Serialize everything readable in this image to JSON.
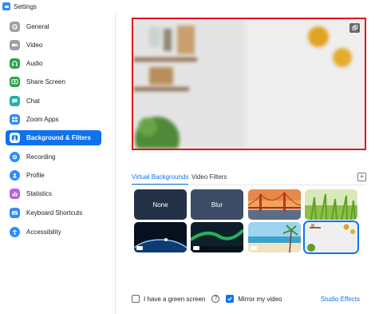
{
  "window": {
    "title": "Settings",
    "icon": "zoom-app-icon"
  },
  "sidebar": {
    "items": [
      {
        "label": "General",
        "icon": "gear-icon",
        "color": "#9aa0a6",
        "active": false
      },
      {
        "label": "Video",
        "icon": "video-icon",
        "color": "#9aa0a6",
        "active": false
      },
      {
        "label": "Audio",
        "icon": "headphones-icon",
        "color": "#2fa24a",
        "active": false
      },
      {
        "label": "Share Screen",
        "icon": "share-screen-icon",
        "color": "#2fa24a",
        "active": false
      },
      {
        "label": "Chat",
        "icon": "chat-icon",
        "color": "#1ab3a6",
        "active": false
      },
      {
        "label": "Zoom Apps",
        "icon": "zoom-apps-icon",
        "color": "#2d8cff",
        "active": false
      },
      {
        "label": "Background & Filters",
        "icon": "background-icon",
        "color": "#ffffff",
        "active": true
      },
      {
        "label": "Recording",
        "icon": "record-icon",
        "color": "#2d8cff",
        "active": false
      },
      {
        "label": "Profile",
        "icon": "profile-icon",
        "color": "#2d8cff",
        "active": false
      },
      {
        "label": "Statistics",
        "icon": "statistics-icon",
        "color": "#b764e0",
        "active": false
      },
      {
        "label": "Keyboard Shortcuts",
        "icon": "keyboard-icon",
        "color": "#2d8cff",
        "active": false
      },
      {
        "label": "Accessibility",
        "icon": "accessibility-icon",
        "color": "#2d8cff",
        "active": false
      }
    ]
  },
  "preview": {
    "swap_icon": "swap-camera-icon",
    "border_color": "#e0161b"
  },
  "tabs": [
    {
      "label": "Virtual Backgrounds",
      "active": true
    },
    {
      "label": "Video Filters",
      "active": false
    }
  ],
  "add_button": {
    "icon": "add-icon"
  },
  "backgrounds": [
    {
      "label": "None",
      "kind": "none"
    },
    {
      "label": "Blur",
      "kind": "blur"
    },
    {
      "label": "",
      "kind": "golden-gate-bridge"
    },
    {
      "label": "",
      "kind": "grass"
    },
    {
      "label": "",
      "kind": "earth-from-space"
    },
    {
      "label": "",
      "kind": "aurora"
    },
    {
      "label": "",
      "kind": "beach"
    },
    {
      "label": "",
      "kind": "room"
    }
  ],
  "options": {
    "green_screen": {
      "label": "I have a green screen",
      "checked": false
    },
    "mirror_video": {
      "label": "Mirror my video",
      "checked": true
    },
    "help_icon": "help-icon",
    "studio_effects": "Studio Effects"
  },
  "colors": {
    "accent": "#0e72ed"
  }
}
